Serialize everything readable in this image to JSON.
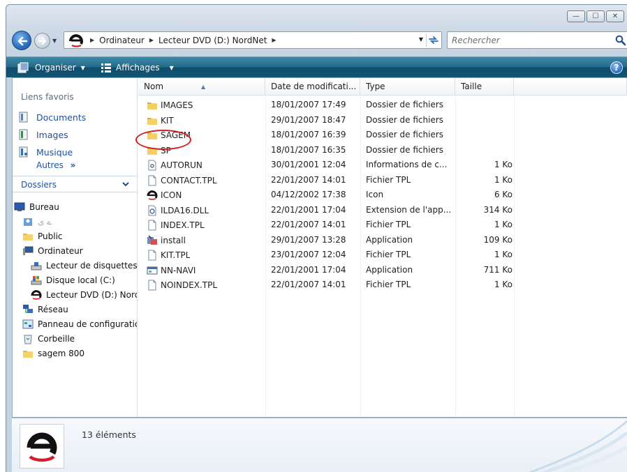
{
  "window": {
    "caption_minimize": "—",
    "caption_maximize": "☐",
    "caption_close": "✕"
  },
  "address": {
    "crumbs": [
      "Ordinateur",
      "Lecteur DVD (D:) NordNet"
    ],
    "search_placeholder": "Rechercher"
  },
  "toolbar": {
    "organize": "Organiser",
    "views": "Affichages",
    "help": "?"
  },
  "favorites": {
    "heading": "Liens favoris",
    "items": [
      {
        "label": "Documents",
        "icon": "documents-icon"
      },
      {
        "label": "Images",
        "icon": "pictures-icon"
      },
      {
        "label": "Musique",
        "icon": "music-icon"
      }
    ],
    "others": "Autres",
    "others_arrow": "»"
  },
  "folders": {
    "heading": "Dossiers",
    "tree": [
      {
        "label": "Bureau",
        "icon": "desktop-icon",
        "level": 0
      },
      {
        "label": "ے ی",
        "icon": "user-folder-icon",
        "level": 1
      },
      {
        "label": "Public",
        "icon": "folder-icon",
        "level": 1
      },
      {
        "label": "Ordinateur",
        "icon": "computer-icon",
        "level": 1
      },
      {
        "label": "Lecteur de disquettes",
        "icon": "floppy-icon",
        "level": 2
      },
      {
        "label": "Disque local (C:)",
        "icon": "hard-disk-icon",
        "level": 2
      },
      {
        "label": "Lecteur DVD (D:) NordNet",
        "icon": "nordnet-icon",
        "level": 2
      },
      {
        "label": "Réseau",
        "icon": "network-icon",
        "level": 1
      },
      {
        "label": "Panneau de configuration",
        "icon": "control-panel-icon",
        "level": 1
      },
      {
        "label": "Corbeille",
        "icon": "recycle-bin-icon",
        "level": 1
      },
      {
        "label": "sagem 800",
        "icon": "folder-icon",
        "level": 1
      }
    ]
  },
  "columns": {
    "name": "Nom",
    "date": "Date de modificati...",
    "type": "Type",
    "size": "Taille",
    "sort_indicator": "▲"
  },
  "files": [
    {
      "name": "IMAGES",
      "date": "18/01/2007 17:49",
      "type": "Dossier de fichiers",
      "size": "",
      "icon": "folder-icon"
    },
    {
      "name": "KIT",
      "date": "29/01/2007 18:47",
      "type": "Dossier de fichiers",
      "size": "",
      "icon": "folder-icon"
    },
    {
      "name": "SAGEM",
      "date": "18/01/2007 16:39",
      "type": "Dossier de fichiers",
      "size": "",
      "icon": "folder-icon"
    },
    {
      "name": "SP",
      "date": "18/01/2007 16:35",
      "type": "Dossier de fichiers",
      "size": "",
      "icon": "folder-icon"
    },
    {
      "name": "AUTORUN",
      "date": "30/01/2001 12:04",
      "type": "Informations de c...",
      "size": "1 Ko",
      "icon": "settings-file-icon"
    },
    {
      "name": "CONTACT.TPL",
      "date": "22/01/2007 14:01",
      "type": "Fichier TPL",
      "size": "1 Ko",
      "icon": "file-icon"
    },
    {
      "name": "ICON",
      "date": "04/12/2002 17:38",
      "type": "Icon",
      "size": "6 Ko",
      "icon": "nordnet-icon"
    },
    {
      "name": "ILDA16.DLL",
      "date": "22/01/2001 17:04",
      "type": "Extension de l'app...",
      "size": "314 Ko",
      "icon": "dll-file-icon"
    },
    {
      "name": "INDEX.TPL",
      "date": "22/01/2007 14:01",
      "type": "Fichier TPL",
      "size": "1 Ko",
      "icon": "file-icon"
    },
    {
      "name": "install",
      "date": "29/01/2007 13:28",
      "type": "Application",
      "size": "109 Ko",
      "icon": "installer-icon"
    },
    {
      "name": "KIT.TPL",
      "date": "23/01/2007 12:04",
      "type": "Fichier TPL",
      "size": "1 Ko",
      "icon": "file-icon"
    },
    {
      "name": "NN-NAVI",
      "date": "22/01/2001 17:04",
      "type": "Application",
      "size": "711 Ko",
      "icon": "application-icon"
    },
    {
      "name": "NOINDEX.TPL",
      "date": "22/01/2007 14:01",
      "type": "Fichier TPL",
      "size": "1 Ko",
      "icon": "file-icon"
    }
  ],
  "details": {
    "count": "13 éléments",
    "icon": "nordnet-icon"
  },
  "colors": {
    "toolbar": "#115572",
    "link": "#1d50a0",
    "highlight_circle": "#d12020",
    "nordnet_red": "#d4202a"
  }
}
